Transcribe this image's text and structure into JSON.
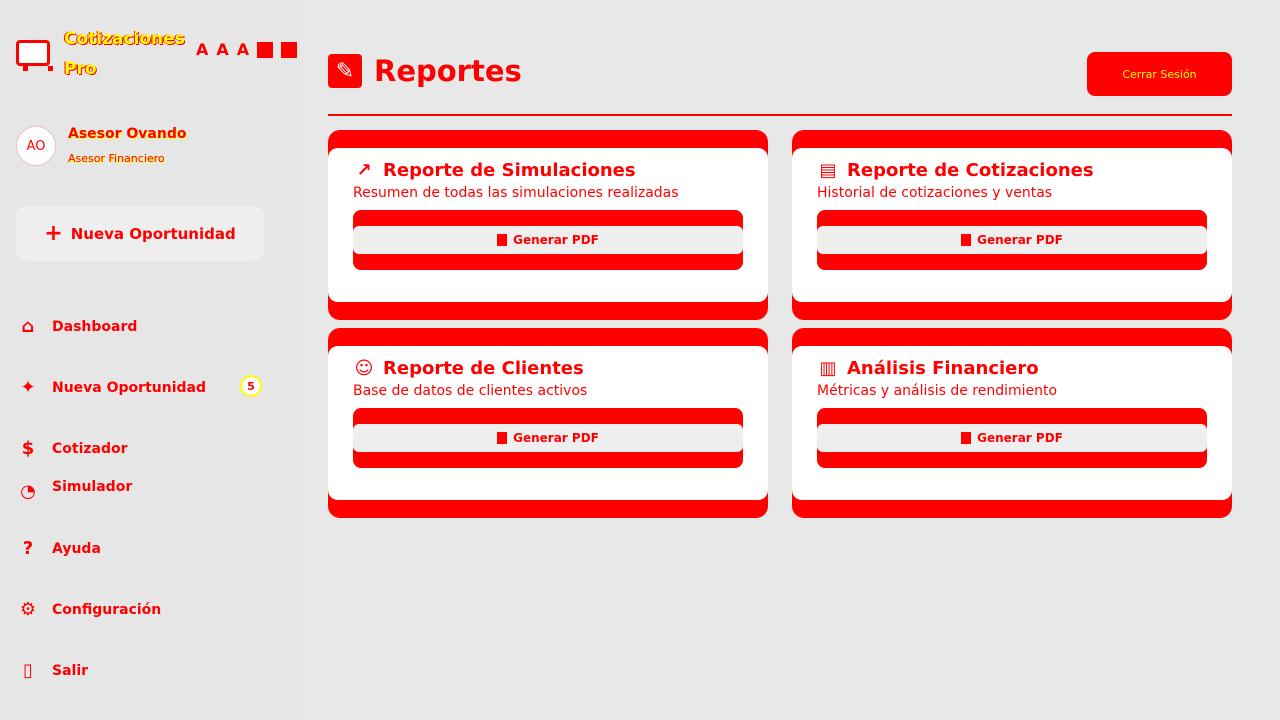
{
  "brand": {
    "name": "Cotizaciones Pro"
  },
  "font_controls": [
    "A",
    "A",
    "A"
  ],
  "user": {
    "initials": "AO",
    "name": "Asesor Ovando",
    "role": "Asesor Financiero"
  },
  "sidebar": {
    "new_opportunity": "Nueva Oportunidad",
    "items": [
      {
        "label": "Dashboard",
        "icon": "home-icon"
      },
      {
        "label": "Nueva Oportunidad",
        "icon": "sparkle-icon",
        "badge": "5"
      },
      {
        "label": "Cotizador",
        "icon": "money-bag-icon"
      },
      {
        "label": "Simulador",
        "icon": "chart-icon"
      }
    ],
    "bottom_items": [
      {
        "label": "Ayuda",
        "icon": "question-icon"
      },
      {
        "label": "Configuración",
        "icon": "gear-icon"
      },
      {
        "label": "Salir",
        "icon": "exit-icon"
      }
    ]
  },
  "main": {
    "title": "Reportes",
    "close_button": "Cerrar Sesión"
  },
  "reports": [
    {
      "title": "Reporte de Simulaciones",
      "description": "Resumen de todas las simulaciones realizadas",
      "button": "Generar PDF",
      "icon": "chart-up-icon"
    },
    {
      "title": "Reporte de Cotizaciones",
      "description": "Historial de cotizaciones y ventas",
      "button": "Generar PDF",
      "icon": "document-icon"
    },
    {
      "title": "Reporte de Clientes",
      "description": "Base de datos de clientes activos",
      "button": "Generar PDF",
      "icon": "people-icon"
    },
    {
      "title": "Análisis Financiero",
      "description": "Métricas y análisis de rendimiento",
      "button": "Generar PDF",
      "icon": "bar-chart-icon"
    }
  ],
  "colors": {
    "primary": "#ff0000",
    "accent": "#ffff00",
    "background": "#e8e8e8",
    "card": "#ffffff"
  }
}
